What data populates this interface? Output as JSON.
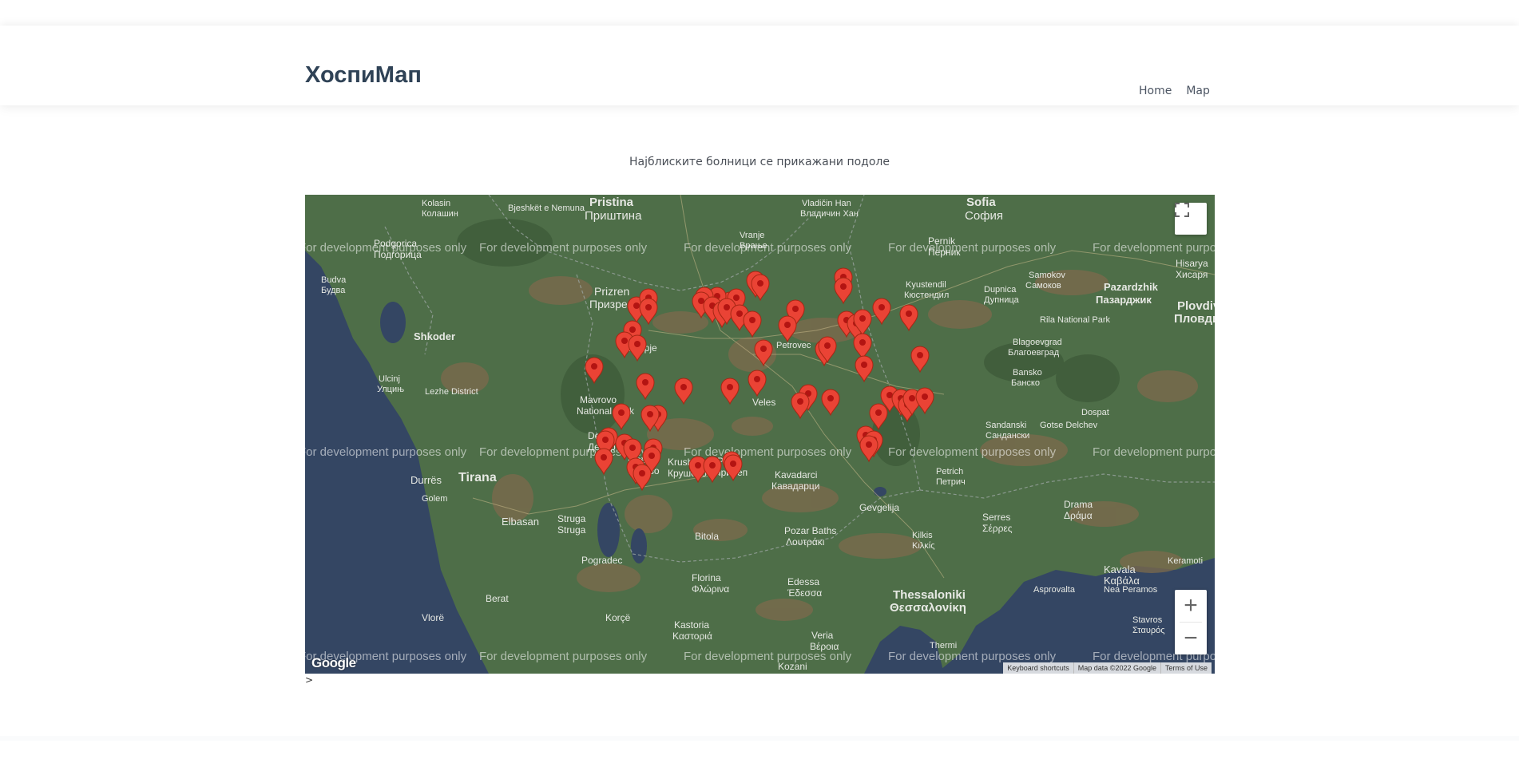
{
  "header": {
    "brand": "ХоспиМап",
    "nav": [
      {
        "label": "Home"
      },
      {
        "label": "Map"
      }
    ]
  },
  "main": {
    "subtitle": "Најблиските болници се прикажани подоле",
    "after_map": ">"
  },
  "map": {
    "watermark": "For development purposes only",
    "logo": "Google",
    "attribution": {
      "shortcuts": "Keyboard shortcuts",
      "data": "Map data ©2022 Google",
      "terms": "Terms of Use"
    },
    "zoom_in": "+",
    "zoom_out": "−",
    "labels": [
      "Pristina",
      "Приштина",
      "Sofia",
      "София",
      "Prizren",
      "Призрен",
      "Shkoder",
      "Ulcinj",
      "Улцињ",
      "Lezhe District",
      "Mavrovo",
      "National Park",
      "Tirana",
      "Durrës",
      "Elbasan",
      "Struga",
      "Kicevo",
      "Кичево",
      "Krushevo",
      "Крушево",
      "Prilep",
      "Прилеп",
      "Kavadarci",
      "Кавадарци",
      "Pozar Baths",
      "Λουτράκι",
      "Florina",
      "Φλώρινα",
      "Kastoria",
      "Καστοριά",
      "Edessa",
      "Έδεσσα",
      "Veria",
      "Βέροια",
      "Thessaloniki",
      "Θεσσαλονίκη",
      "Kozani",
      "Korçë",
      "Pogradec",
      "Berat",
      "Vlorë",
      "Pernik",
      "Перник",
      "Kyustendil",
      "Кюстендил",
      "Dupnica",
      "Дупница",
      "Blagoevgrad",
      "Благоевград",
      "Pazardzhik",
      "Пазарджик",
      "Plovdiv",
      "Пловдив",
      "Sandanski",
      "Сандански",
      "Petrich",
      "Петрич",
      "Serres",
      "Σέρρες",
      "Drama",
      "Δράμα",
      "Kavala",
      "Καβάλα",
      "Gevgelija",
      "Samokov",
      "Самоков",
      "Rila National Park",
      "Bansko",
      "Банско",
      "Dospat",
      "Gotse Delchev",
      "Kilkis",
      "Κιλκίς",
      "Thermi",
      "Budva",
      "Будва",
      "Podgorica",
      "Подгорица",
      "Kolasin",
      "Колашин",
      "Vranje",
      "Врање",
      "Vladičin Han",
      "Владичин Хан",
      "Stavros",
      "Σταυρός",
      "Asprovalta",
      "Nea Peramos",
      "Keramoti",
      "Golem",
      "Bjeshkët e Nemuna",
      "Hisarya",
      "Хисаря",
      "Petrovec",
      "Veles",
      "Debar",
      "Дебар",
      "Bitola",
      "Struga",
      "Skopje"
    ]
  }
}
